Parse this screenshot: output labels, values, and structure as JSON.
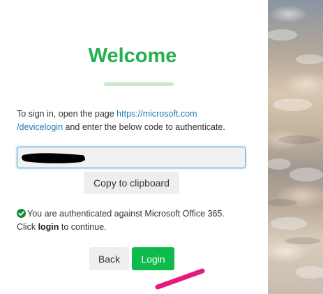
{
  "welcome": {
    "title": "Welcome"
  },
  "instructions": {
    "prefix": "To sign in, open the page ",
    "link_text_line1": "https://microsoft.com",
    "link_text_line2": "/devicelogin",
    "suffix": " and enter the below code to authenticate."
  },
  "code_field": {
    "value": ""
  },
  "buttons": {
    "copy": "Copy to clipboard",
    "back": "Back",
    "login": "Login"
  },
  "status": {
    "message": "You are authenticated against Microsoft Office 365.",
    "prefix2": "Click ",
    "bold_word": "login",
    "suffix2": " to continue."
  },
  "icons": {
    "status": "check-circle-icon"
  },
  "colors": {
    "accent_green": "#22b14c",
    "login_green": "#0fba4d",
    "link_blue": "#1a7fb5",
    "focus_blue": "#4aa3df",
    "annotation_pink": "#e8197c",
    "redaction_black": "#000000"
  }
}
